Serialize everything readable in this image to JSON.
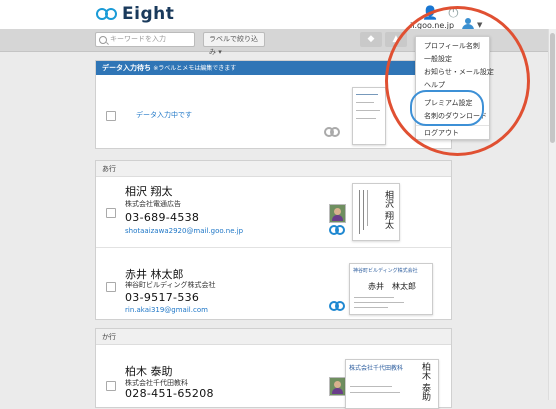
{
  "app": {
    "name": "Eight"
  },
  "header": {
    "user_email": "il.goo.ne.jp"
  },
  "toolbar": {
    "search_placeholder": "キーワードを入力",
    "label_filter": "ラベルで絞り込み ▾"
  },
  "menu": {
    "items": [
      {
        "label": "プロフィール名刺"
      },
      {
        "label": "一般設定"
      },
      {
        "label": "お知らせ・メール設定"
      },
      {
        "label": "ヘルプ"
      },
      {
        "label": "プレミアム設定"
      },
      {
        "label": "名刺のダウンロード"
      },
      {
        "label": "ログアウト"
      }
    ]
  },
  "pending": {
    "title": "データ入力待ち",
    "note": "※ラベルとメモは編集できます",
    "status": "データ入力中です"
  },
  "groups": [
    {
      "header": "あ行",
      "contacts": [
        {
          "name": "相沢 翔太",
          "company": "株式会社電通広告",
          "phone": "03-689-4538",
          "email": "shotaaizawa2920@mail.goo.ne.jp",
          "card_name": "相沢 翔太"
        },
        {
          "name": "赤井 林太郎",
          "company": "神谷町ビルディング株式会社",
          "phone": "03-9517-536",
          "email": "rin.akai319@gmail.com",
          "card_company": "神谷町ビルディング株式会社",
          "card_name": "赤井　林太郎"
        }
      ]
    },
    {
      "header": "か行",
      "contacts": [
        {
          "name": "柏木 泰助",
          "company": "株式会社千代田教科",
          "phone": "028-451-65208",
          "email": "",
          "card_company": "株式会社千代田教科",
          "card_name": "柏木 泰助"
        }
      ]
    }
  ],
  "colors": {
    "brand": "#1a9bd7",
    "pending_bar": "#2f75b6",
    "annotation_red": "#e05032",
    "annotation_blue": "#3d90d6"
  }
}
